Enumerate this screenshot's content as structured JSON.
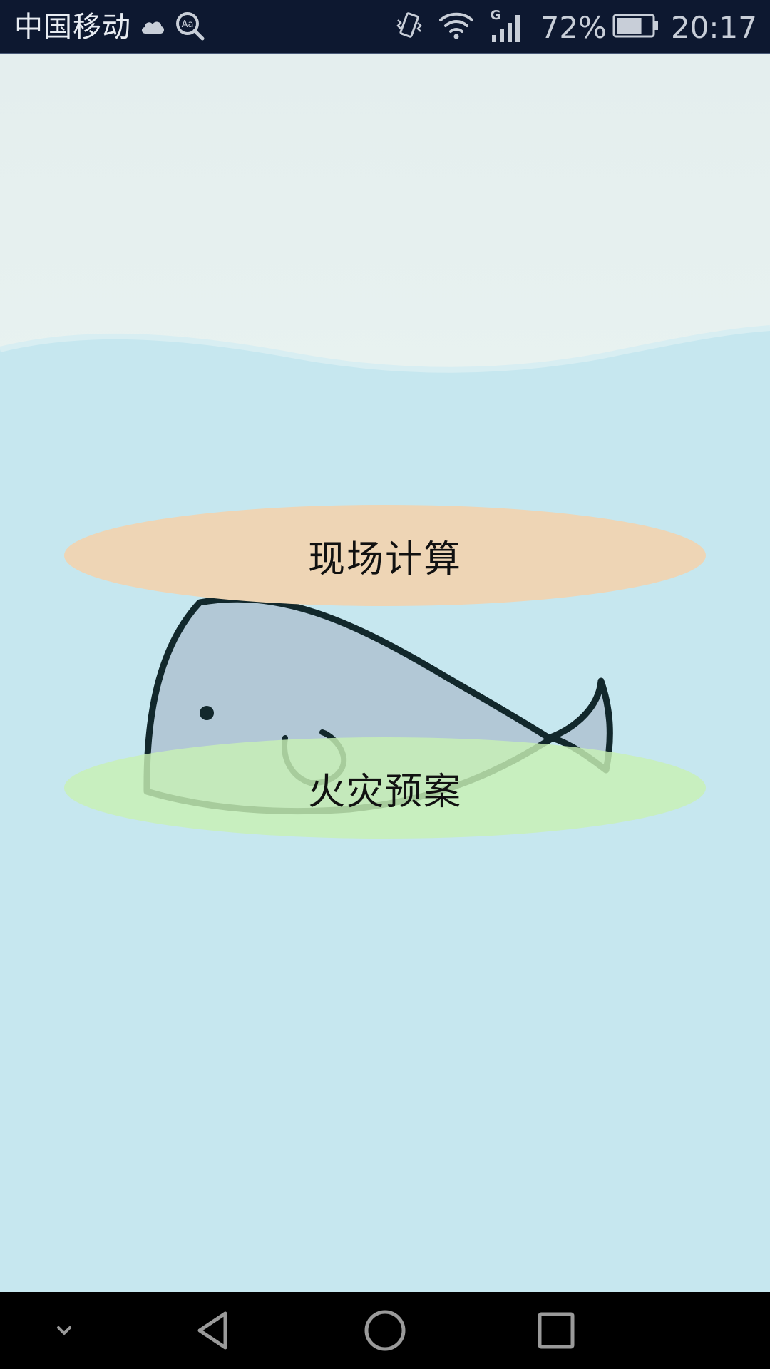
{
  "status_bar": {
    "carrier": "中国移动",
    "network_type": "G",
    "battery_percent": "72%",
    "battery_level": 0.72,
    "time": "20:17",
    "icons": [
      "cloud-icon",
      "accessibility-search-icon",
      "vibrate-icon",
      "wifi-icon",
      "cell-signal-icon",
      "battery-icon"
    ]
  },
  "main": {
    "buttons": [
      {
        "label": "现场计算",
        "color": "#eed5b5"
      },
      {
        "label": "火灾预案",
        "color": "#c8f0b4"
      }
    ]
  },
  "nav_bar": {
    "icons": [
      "chevron-down-icon",
      "back-icon",
      "home-icon",
      "recents-icon"
    ]
  },
  "colors": {
    "status_bar_bg": "#0d1830",
    "water": "#c6e7ef",
    "sky": "#e6f0ef",
    "nav_bar_bg": "#000000"
  }
}
